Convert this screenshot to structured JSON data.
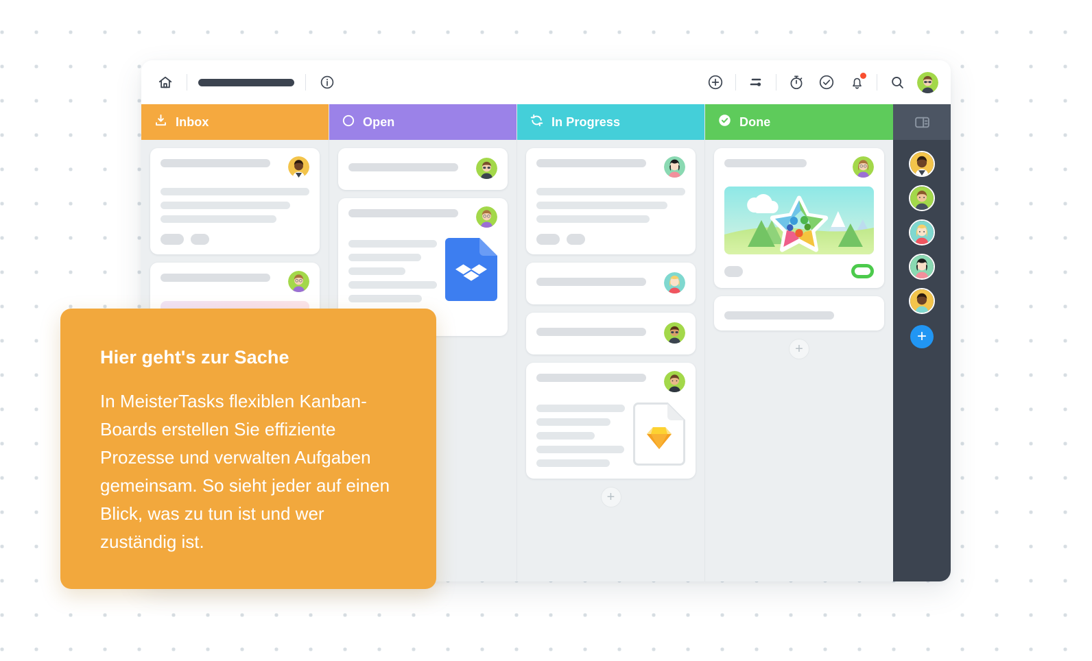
{
  "window": {
    "topbar": {
      "home_icon": "home-icon",
      "project_name_pill": "",
      "info_icon": "info-icon",
      "actions": [
        {
          "name": "add-icon",
          "label": ""
        },
        {
          "name": "filter-icon",
          "label": ""
        },
        {
          "name": "timer-icon",
          "label": ""
        },
        {
          "name": "check-circle-icon",
          "label": ""
        },
        {
          "name": "notifications-bell-icon",
          "label": "",
          "badge": true
        },
        {
          "name": "search-icon",
          "label": ""
        }
      ],
      "avatar": "user-avatar"
    },
    "columns": [
      {
        "label": "Inbox",
        "color": "#f5a93f",
        "icon": "inbox-download-icon",
        "cards": [
          {
            "type": "text",
            "lines": 3,
            "chips": 2,
            "avatar": "avatar-1"
          },
          {
            "type": "image",
            "preview": "pink-gradient-preview",
            "avatar": "avatar-2"
          }
        ]
      },
      {
        "label": "Open",
        "color": "#9b82e8",
        "icon": "open-circle-icon",
        "cards": [
          {
            "type": "title-only",
            "avatar": "avatar-3"
          },
          {
            "type": "attachment",
            "attachment": "dropbox-file-icon",
            "lines": 5,
            "chips": 2,
            "avatar": "avatar-4"
          }
        ]
      },
      {
        "label": "In Progress",
        "color": "#44cfd9",
        "icon": "in-progress-sync-icon",
        "cards": [
          {
            "type": "text",
            "lines": 3,
            "chips": 2,
            "avatar": "avatar-5"
          },
          {
            "type": "title-only",
            "avatar": "avatar-6"
          },
          {
            "type": "title-only",
            "avatar": "avatar-7"
          },
          {
            "type": "attachment",
            "attachment": "sketch-file-icon",
            "lines": 5,
            "avatar": "avatar-8"
          }
        ],
        "add_card_label": "+"
      },
      {
        "label": "Done",
        "color": "#5ecb5b",
        "icon": "done-check-icon",
        "cards": [
          {
            "type": "image",
            "preview": "landscape-star-preview",
            "badge": "green-pill-badge",
            "avatar": "avatar-9"
          },
          {
            "type": "title-only",
            "avatar": null
          }
        ],
        "add_card_label": "+"
      }
    ],
    "member_bar": {
      "panel_toggle_icon": "panel-toggle-icon",
      "members": [
        {
          "name": "member-avatar-1",
          "bg": "#f3c44b"
        },
        {
          "name": "member-avatar-2",
          "bg": "#a3d84a"
        },
        {
          "name": "member-avatar-3",
          "bg": "#7fd8cf"
        },
        {
          "name": "member-avatar-4",
          "bg": "#8ad9b2"
        },
        {
          "name": "member-avatar-5",
          "bg": "#f3c44b"
        }
      ],
      "add_member_label": "+"
    }
  },
  "tooltip": {
    "title": "Hier geht's zur Sache",
    "body": "In MeisterTasks flexiblen Kanban-Boards erstellen Sie effiziente Prozesse und verwalten Aufgaben gemeinsam. So sieht jeder auf einen Blick, was zu tun ist und wer zuständig ist.",
    "background": "#f2a83d"
  },
  "background": {
    "dot_color": "#d7dee3",
    "page_color": "#ffffff"
  }
}
